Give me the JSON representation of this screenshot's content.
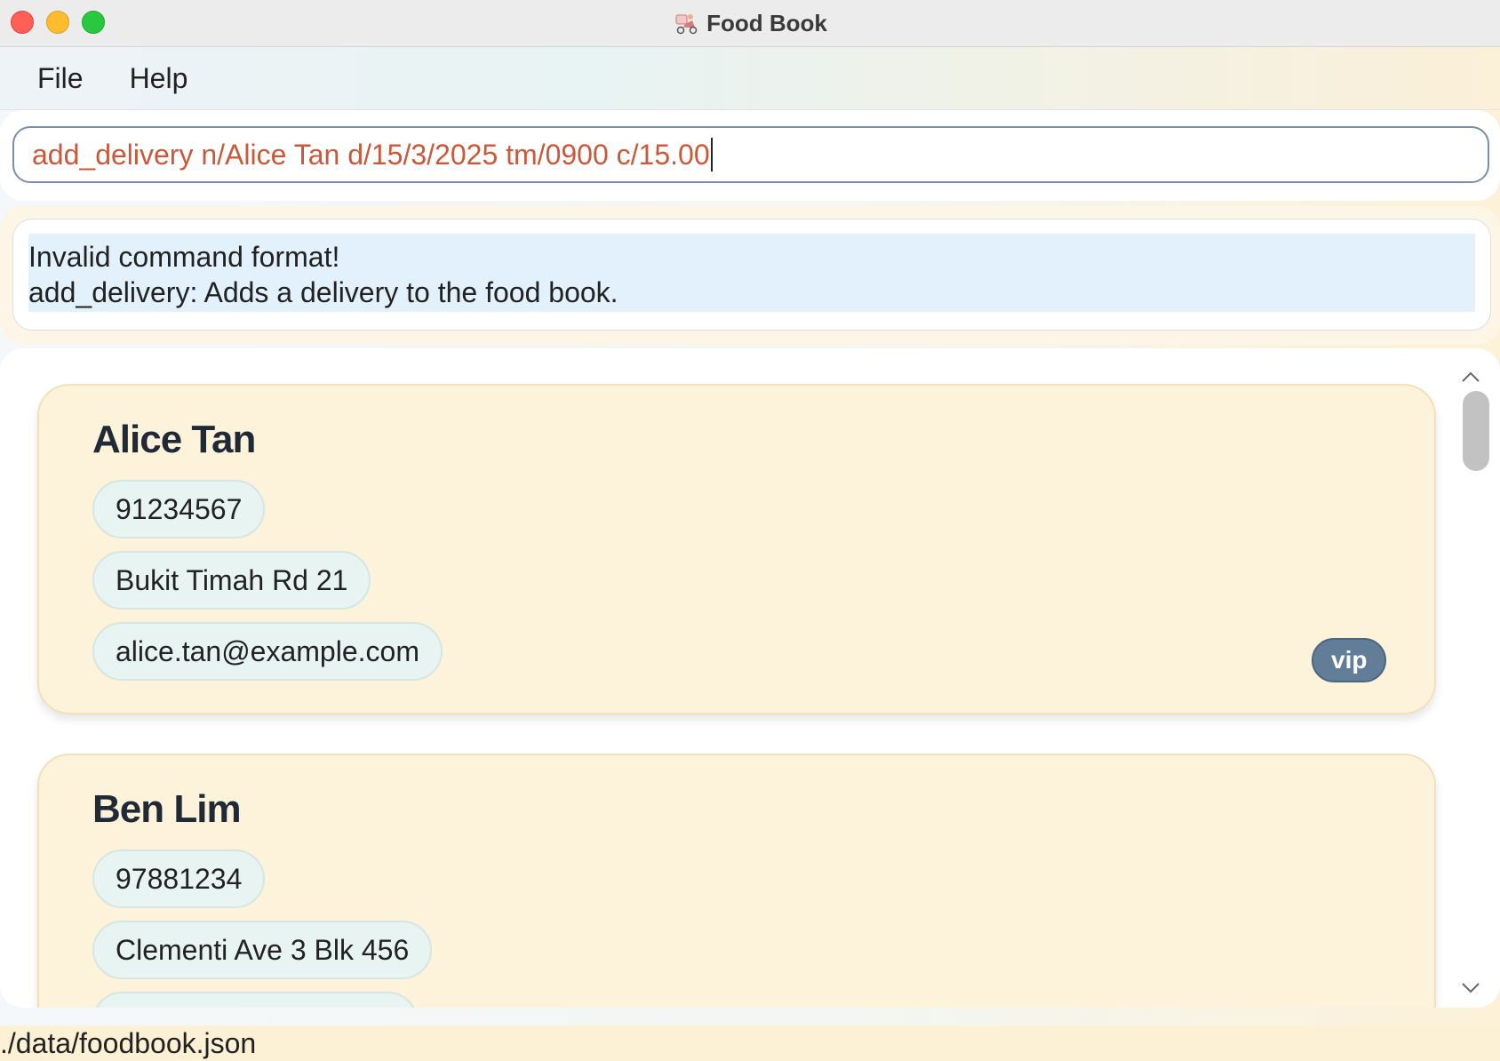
{
  "window": {
    "title": "Food Book",
    "icon": "food-delivery-icon"
  },
  "menu": {
    "items": [
      {
        "label": "File"
      },
      {
        "label": "Help"
      }
    ]
  },
  "command_box": {
    "value": "add_delivery n/Alice Tan d/15/3/2025 tm/0900 c/15.00",
    "text_color": "#c9593a"
  },
  "result_box": {
    "line1": "Invalid command format!",
    "line2": "add_delivery: Adds a delivery to the food book."
  },
  "customers": [
    {
      "name": "Alice Tan",
      "phone": "91234567",
      "address": "Bukit Timah Rd 21",
      "email": "alice.tan@example.com",
      "tag": "vip"
    },
    {
      "name": "Ben Lim",
      "phone": "97881234",
      "address": "Clementi Ave 3 Blk 456"
    }
  ],
  "status_bar": {
    "file_path": "./data/foodbook.json"
  },
  "colors": {
    "card_background": "#fdf3da",
    "chip_background": "#e8f4f1",
    "tag_background": "#627d98"
  }
}
